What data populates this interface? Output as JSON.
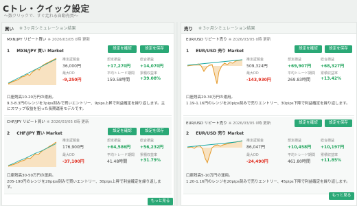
{
  "page": {
    "title": "Cトレ・クイック設定",
    "subtitle": "～数クリックで、すぐ走れる自動売買～"
  },
  "buy_panel": {
    "name": "買い",
    "note": "※ 3ヶ月シミュレーション結果",
    "more_label": "もっと見る",
    "cards": [
      {
        "header": "MXN/JPY リピート買い",
        "date": "※ 2026/03/05 0時 更新",
        "confirm_label": "設定を確認",
        "save_label": "設定を保存",
        "rank": "1",
        "name": "MXN/JPY 買い Market",
        "labels": [
          "推定証拠金",
          "想定損益",
          "総合損益",
          "最大DD",
          "平均トレード期間",
          "累積収益率"
        ],
        "values": [
          "36,000円",
          "+17,270円",
          "+14,070円",
          "-9,250円",
          "159.58時間",
          "+39.08%"
        ],
        "desc": "口座残高10-20万円の運用。\n9.3-8.3円のレンジを7pips刻みで買いエントリー、9pips上昇で利益確定を繰り返します。主にスワップ収益を狙った長期運用モデルです。"
      },
      {
        "header": "CHF/JPY リピート買い",
        "date": "※ 2026/03/05 0時 更新",
        "confirm_label": "設定を確認",
        "save_label": "設定を保存",
        "rank": "2",
        "name": "CHF/JPY 買い Market",
        "labels": [
          "推定証拠金",
          "想定損益",
          "総合損益",
          "最大DD",
          "平均トレード期間",
          "累積収益率"
        ],
        "values": [
          "176,900円",
          "+64,586円",
          "+56,232円",
          "-37,100円",
          "41.48時間",
          "+31.79%"
        ],
        "desc": "口座残高30-50万円の運用。\n205-190円のレンジを20pips刻みで買いエントリー、30pips上昇で利益確定を繰り返します。"
      }
    ]
  },
  "sell_panel": {
    "name": "売り",
    "note": "※ 3ヶ月シミュレーション結果",
    "more_label": "もっと見る",
    "cards": [
      {
        "header": "EUR/USD リピート売り",
        "date": "※ 2026/03/05 0時 更新",
        "confirm_label": "設定を確認",
        "save_label": "設定を保存",
        "rank": "1",
        "name": "EUR/USD 売り Market",
        "labels": [
          "推定証拠金",
          "想定損益",
          "総合損益",
          "最大DD",
          "平均トレード期間",
          "累積収益率"
        ],
        "values": [
          "509,324円",
          "+69,907円",
          "+68,327円",
          "-143,930円",
          "269.83時間",
          "+13.42%"
        ],
        "desc": "口座残高20-30万円の運用。\n1.19-1.16円のレンジを20pips刻みで売りエントリー、30pips下降で利益確定を繰り返します。"
      },
      {
        "header": "EUR/USD リピート売り",
        "date": "※ 2026/03/05 0時 更新",
        "confirm_label": "設定を確認",
        "save_label": "設定を保存",
        "rank": "2",
        "name": "EUR/USD 売り Market",
        "labels": [
          "推定証拠金",
          "想定損益",
          "総合損益",
          "最大DD",
          "平均トレード期間",
          "累積収益率"
        ],
        "values": [
          "86,047円",
          "+10,458円",
          "+10,197円",
          "-24,490円",
          "461.80時間",
          "+11.85%"
        ],
        "desc": "口座残高5-10万円の運用。\n1.20-1.16円のレンジを20pips刻みで売りエントリー、45pips下降で利益確定を繰り返します。"
      }
    ]
  },
  "colors": {
    "accent": "#2aa876",
    "positive": "#1ea35a",
    "negative": "#e02a1c",
    "line_teal": "#1aa7a0",
    "line_orange": "#e59a2b"
  }
}
